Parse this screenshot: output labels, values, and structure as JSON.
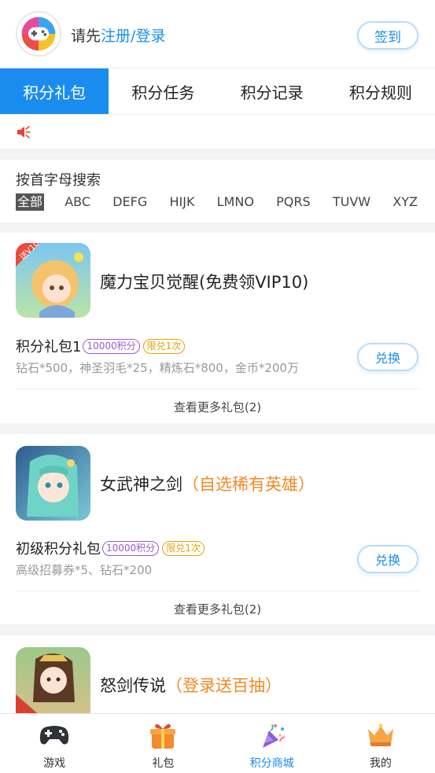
{
  "header": {
    "prompt_prefix": "请先",
    "register_label": "注册",
    "separator": "/",
    "login_label": "登录",
    "signin_label": "签到"
  },
  "tabs": [
    {
      "label": "积分礼包",
      "active": true
    },
    {
      "label": "积分任务",
      "active": false
    },
    {
      "label": "积分记录",
      "active": false
    },
    {
      "label": "积分规则",
      "active": false
    }
  ],
  "notice": {
    "icon": "speaker-icon",
    "color": "#e8423a"
  },
  "search": {
    "title": "按首字母搜索",
    "letters": [
      "全部",
      "ABC",
      "DEFG",
      "HIJK",
      "LMNO",
      "PQRS",
      "TUVW",
      "XYZ"
    ],
    "active_index": 0
  },
  "games": [
    {
      "title": "魔力宝贝觉醒(免费领VIP10)",
      "highlight": "",
      "icon_badge": "送V10",
      "package": {
        "name": "积分礼包1",
        "points_badge": "10000积分",
        "limit_badge": "限兑1次",
        "desc": "钻石*500，神圣羽毛*25，精炼石*800，金币*200万",
        "button": "兑换"
      },
      "more": "查看更多礼包(2)"
    },
    {
      "title": "女武神之剑",
      "highlight": "（自选稀有英雄）",
      "icon_badge": "",
      "package": {
        "name": "初级积分礼包",
        "points_badge": "10000积分",
        "limit_badge": "限兑1次",
        "desc": "高级招募券*5、钻石*200",
        "button": "兑换"
      },
      "more": "查看更多礼包(2)"
    },
    {
      "title": "怒剑传说",
      "highlight": "（登录送百抽）",
      "icon_badge": "",
      "package": null,
      "more": ""
    }
  ],
  "bottom_nav": [
    {
      "label": "游戏",
      "icon": "gamepad-icon",
      "active": false
    },
    {
      "label": "礼包",
      "icon": "gift-icon",
      "active": false
    },
    {
      "label": "积分商城",
      "icon": "party-popper-icon",
      "active": true
    },
    {
      "label": "我的",
      "icon": "crown-icon",
      "active": false
    }
  ],
  "colors": {
    "accent": "#1a8cf0",
    "highlight": "#f08a24",
    "points_badge": "#9b59d0",
    "limit_badge": "#e6a100"
  }
}
